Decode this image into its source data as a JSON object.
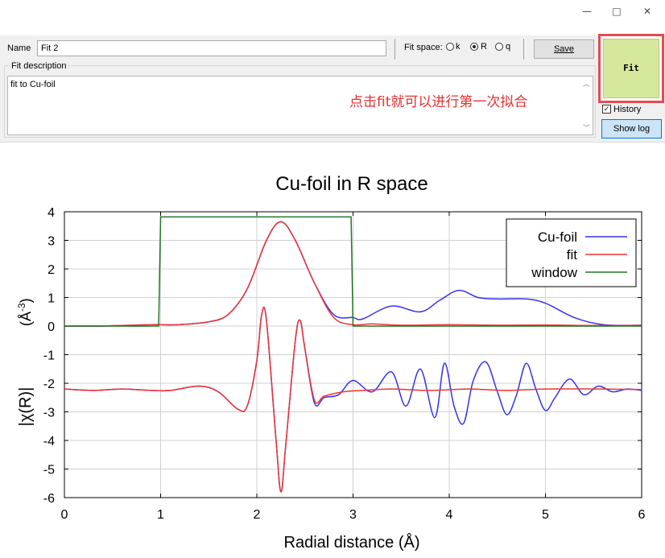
{
  "window": {
    "minimize_glyph": "—",
    "maximize_glyph": "□",
    "close_glyph": "✕"
  },
  "form": {
    "name_label": "Name",
    "name_value": "Fit 2",
    "fit_space_label": "Fit space:",
    "fit_space_options": [
      "k",
      "R",
      "q"
    ],
    "fit_space_selected": "R",
    "save_label": "Save",
    "description_label": "Fit description",
    "description_value": "fit to Cu-foil",
    "annotation": "点击fit就可以进行第一次拟合",
    "fit_label": "Fit",
    "history_label": "History",
    "history_checked": true,
    "showlog_label": "Show log",
    "colors": {
      "annotation": "#e8302e",
      "fit_button": "#d4e99b",
      "highlight_border": "#e84a4f"
    }
  },
  "chart_data": {
    "type": "line",
    "title": "Cu-foil in R space",
    "xlabel": "Radial distance   (Å)",
    "ylabel_main": "|χ(R)|",
    "ylabel_unit_base": "(Å",
    "ylabel_unit_exp": "-3",
    "ylabel_unit_close": ")",
    "xlim": [
      0,
      6
    ],
    "ylim": [
      -6,
      4
    ],
    "xticks": [
      0,
      1,
      2,
      3,
      4,
      5,
      6
    ],
    "yticks": [
      -6,
      -5,
      -4,
      -3,
      -2,
      -1,
      0,
      1,
      2,
      3,
      4
    ],
    "grid": true,
    "legend_position": "top-right",
    "series": [
      {
        "name": "Cu-foil",
        "color": "#3333ee",
        "x": [
          0,
          0.3,
          0.6,
          0.9,
          1.0,
          1.2,
          1.5,
          1.7,
          1.9,
          2.1,
          2.25,
          2.4,
          2.6,
          2.8,
          3.0,
          3.1,
          3.4,
          3.7,
          3.9,
          4.1,
          4.3,
          4.5,
          4.8,
          5.0,
          5.3,
          5.6,
          6.0
        ],
        "y": [
          0.0,
          0.0,
          0.02,
          0.05,
          0.05,
          0.05,
          0.15,
          0.4,
          1.3,
          3.0,
          3.65,
          3.0,
          1.5,
          0.4,
          0.3,
          0.25,
          0.7,
          0.5,
          0.9,
          1.25,
          1.0,
          0.95,
          0.95,
          0.8,
          0.3,
          0.05,
          0.03
        ]
      },
      {
        "name": "fit",
        "color": "#ee3333",
        "x": [
          0,
          0.3,
          0.6,
          0.9,
          1.0,
          1.2,
          1.5,
          1.7,
          1.9,
          2.1,
          2.25,
          2.4,
          2.6,
          2.8,
          3.0,
          3.2,
          3.5,
          4.0,
          4.5,
          5.0,
          5.5,
          6.0
        ],
        "y": [
          0.0,
          0.0,
          0.02,
          0.05,
          0.05,
          0.05,
          0.15,
          0.4,
          1.3,
          3.0,
          3.65,
          3.0,
          1.5,
          0.3,
          0.05,
          0.08,
          0.03,
          0.05,
          0.03,
          0.04,
          0.02,
          0.02
        ]
      },
      {
        "name": "window",
        "color": "#227722",
        "x": [
          0,
          0.98,
          1.0,
          2.98,
          3.0,
          6.0
        ],
        "y": [
          0.0,
          0.0,
          3.82,
          3.82,
          0.0,
          0.0
        ]
      },
      {
        "name": "",
        "color": "#3333ee",
        "x": [
          0,
          0.3,
          0.6,
          0.9,
          1.1,
          1.4,
          1.6,
          1.8,
          1.9,
          2.0,
          2.05,
          2.1,
          2.2,
          2.25,
          2.3,
          2.4,
          2.45,
          2.5,
          2.6,
          2.7,
          2.85,
          3.0,
          3.2,
          3.4,
          3.55,
          3.7,
          3.85,
          3.95,
          4.05,
          4.15,
          4.25,
          4.38,
          4.5,
          4.6,
          4.7,
          4.8,
          4.9,
          5.0,
          5.1,
          5.25,
          5.4,
          5.55,
          5.7,
          5.85,
          6.0
        ],
        "y": [
          -2.2,
          -2.25,
          -2.2,
          -2.25,
          -2.25,
          -2.1,
          -2.3,
          -2.9,
          -2.8,
          -1.2,
          0.4,
          0.2,
          -4.0,
          -5.8,
          -4.2,
          -0.5,
          0.2,
          -0.8,
          -2.7,
          -2.5,
          -2.4,
          -1.9,
          -2.3,
          -1.6,
          -2.8,
          -1.5,
          -3.2,
          -1.3,
          -2.8,
          -3.4,
          -1.9,
          -1.25,
          -2.3,
          -3.1,
          -2.4,
          -1.3,
          -2.2,
          -2.95,
          -2.5,
          -1.85,
          -2.4,
          -2.1,
          -2.3,
          -2.2,
          -2.25
        ]
      },
      {
        "name": "",
        "color": "#ee3333",
        "x": [
          0,
          0.3,
          0.6,
          0.9,
          1.1,
          1.4,
          1.6,
          1.8,
          1.9,
          2.0,
          2.05,
          2.1,
          2.2,
          2.25,
          2.3,
          2.4,
          2.45,
          2.5,
          2.6,
          2.7,
          2.9,
          3.1,
          3.4,
          3.8,
          4.2,
          4.6,
          5.0,
          5.5,
          6.0
        ],
        "y": [
          -2.2,
          -2.25,
          -2.2,
          -2.25,
          -2.25,
          -2.1,
          -2.3,
          -2.9,
          -2.8,
          -1.2,
          0.4,
          0.2,
          -4.0,
          -5.8,
          -4.2,
          -0.5,
          0.2,
          -0.8,
          -2.6,
          -2.45,
          -2.3,
          -2.25,
          -2.2,
          -2.25,
          -2.2,
          -2.25,
          -2.2,
          -2.2,
          -2.22
        ]
      }
    ]
  }
}
